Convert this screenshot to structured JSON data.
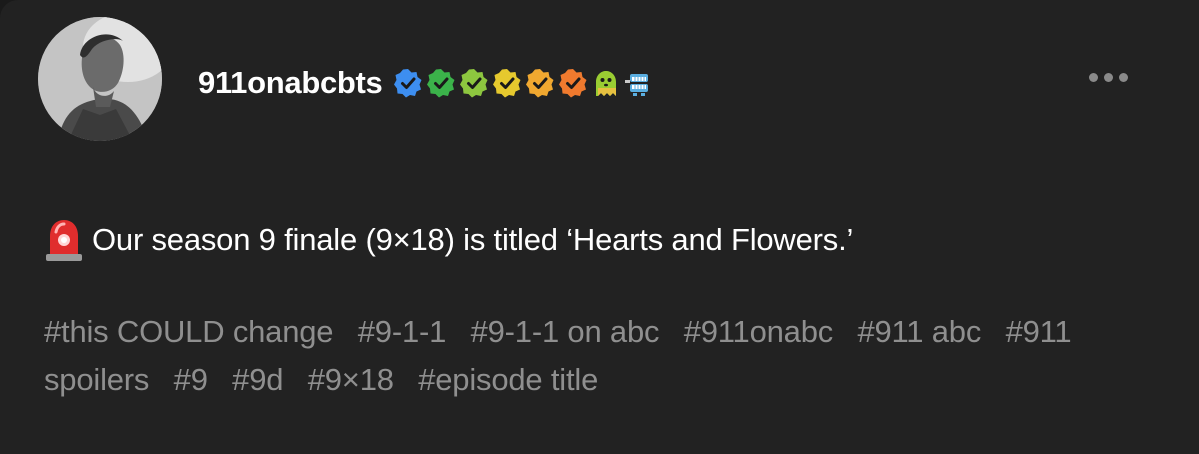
{
  "post": {
    "author": {
      "username": "911onabcbts",
      "badges": [
        {
          "icon": "verified-check-icon",
          "color": "#3d8ef0"
        },
        {
          "icon": "verified-check-icon",
          "color": "#3bb34a"
        },
        {
          "icon": "verified-check-icon",
          "color": "#8dc63f"
        },
        {
          "icon": "verified-check-icon",
          "color": "#e6c92e"
        },
        {
          "icon": "verified-check-icon",
          "color": "#f0a830"
        },
        {
          "icon": "verified-check-icon",
          "color": "#f07a2e"
        },
        {
          "icon": "ghost-emoji-icon",
          "color": "#9acd32"
        },
        {
          "icon": "chattering-teeth-icon",
          "color": "#5aaee0"
        }
      ]
    },
    "body_text": "Our season 9 finale (9×18) is titled ‘Hearts and Flowers.’",
    "tags": [
      "#this COULD change",
      "#9-1-1",
      "#9-1-1 on abc",
      "#911onabc",
      "#911 abc",
      "#911 spoilers",
      "#9",
      "#9d",
      "#9×18",
      "#episode title"
    ]
  },
  "colors": {
    "background": "#222222",
    "text": "#ffffff",
    "tag_text": "#8f8f8f",
    "more_dots": "#8a8a8a"
  }
}
